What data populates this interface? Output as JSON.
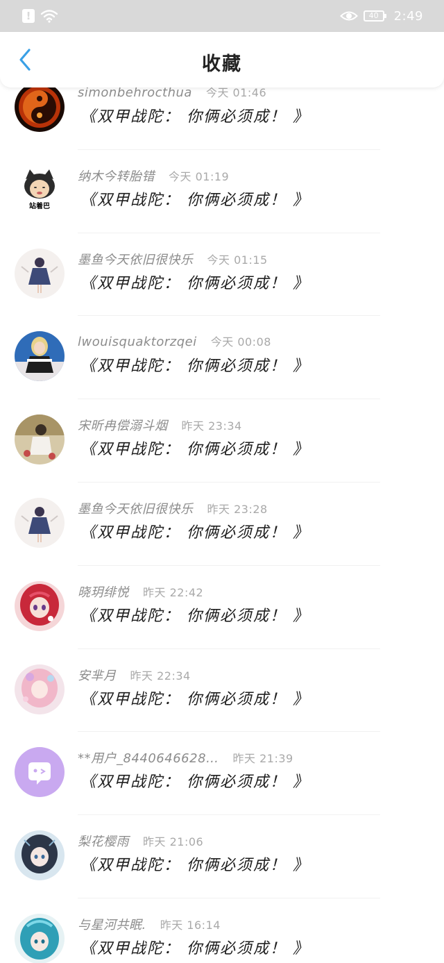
{
  "status_bar": {
    "notification_icon": "!",
    "battery_level": "40",
    "time": "2:49"
  },
  "header": {
    "back_icon": "chevron-left-icon",
    "title": "收藏",
    "accent_color": "#3aa0e6"
  },
  "favorites": [
    {
      "username": "simonbehrocthua",
      "time": "今天 01:46",
      "content": "《双甲战陀： 你俩必须成！ 》",
      "avatar": "yin-yang-fire"
    },
    {
      "username": "纳木今转胎错",
      "time": "今天 01:19",
      "content": "《双甲战陀： 你俩必须成！ 》",
      "avatar": "cat-meme"
    },
    {
      "username": "墨鱼今天依旧很快乐",
      "time": "今天 01:15",
      "content": "《双甲战陀： 你俩必须成！ 》",
      "avatar": "anime-girl-dress"
    },
    {
      "username": "lwouisquaktorzqei",
      "time": "今天 00:08",
      "content": "《双甲战陀： 你俩必须成！ 》",
      "avatar": "photo-girl-blonde"
    },
    {
      "username": "宋昕冉偿溺斗烟",
      "time": "昨天 23:34",
      "content": "《双甲战陀： 你俩必须成！ 》",
      "avatar": "photo-boy"
    },
    {
      "username": "墨鱼今天依旧很快乐",
      "time": "昨天 23:28",
      "content": "《双甲战陀： 你俩必须成！ 》",
      "avatar": "anime-girl-dress"
    },
    {
      "username": "晓玥绯悦",
      "time": "昨天 22:42",
      "content": "《双甲战陀： 你俩必须成！ 》",
      "avatar": "anime-girl-red-hair"
    },
    {
      "username": "安芈月",
      "time": "昨天 22:34",
      "content": "《双甲战陀： 你俩必须成！ 》",
      "avatar": "anime-girl-pink"
    },
    {
      "username": "**用户_8440646628…",
      "time": "昨天 21:39",
      "content": "《双甲战陀： 你俩必须成！ 》",
      "avatar": "default-chat-bubble"
    },
    {
      "username": "梨花樱雨",
      "time": "昨天 21:06",
      "content": "《双甲战陀： 你俩必须成！ 》",
      "avatar": "anime-girl-dark"
    },
    {
      "username": "与星河共眠.",
      "time": "昨天 16:14",
      "content": "《双甲战陀： 你俩必须成！ 》",
      "avatar": "anime-girl-teal"
    }
  ]
}
